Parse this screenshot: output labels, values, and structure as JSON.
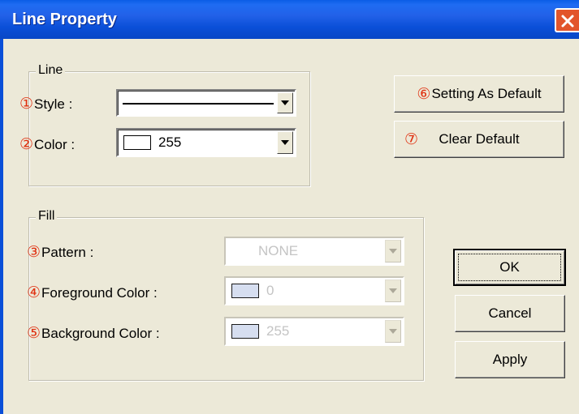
{
  "window": {
    "title": "Line Property"
  },
  "line_group": {
    "legend": "Line",
    "style": {
      "number": "①",
      "label": "Style :"
    },
    "color": {
      "number": "②",
      "label": "Color :",
      "value": "255"
    }
  },
  "fill_group": {
    "legend": "Fill",
    "pattern": {
      "number": "③",
      "label": "Pattern :",
      "value": "NONE"
    },
    "foreground": {
      "number": "④",
      "label": "Foreground Color :",
      "value": "0"
    },
    "background": {
      "number": "⑤",
      "label": "Background Color :",
      "value": "255"
    }
  },
  "buttons": {
    "set_default": {
      "number": "⑥",
      "label": "Setting As Default"
    },
    "clear_default": {
      "number": "⑦",
      "label": "Clear Default"
    },
    "ok": "OK",
    "cancel": "Cancel",
    "apply": "Apply"
  },
  "colors": {
    "accent_number": "#e03010",
    "titlebar": "#0a4fd8",
    "dialog_bg": "#ece9d8"
  },
  "icons": {
    "close": "close-icon",
    "dropdown": "chevron-down-icon"
  }
}
